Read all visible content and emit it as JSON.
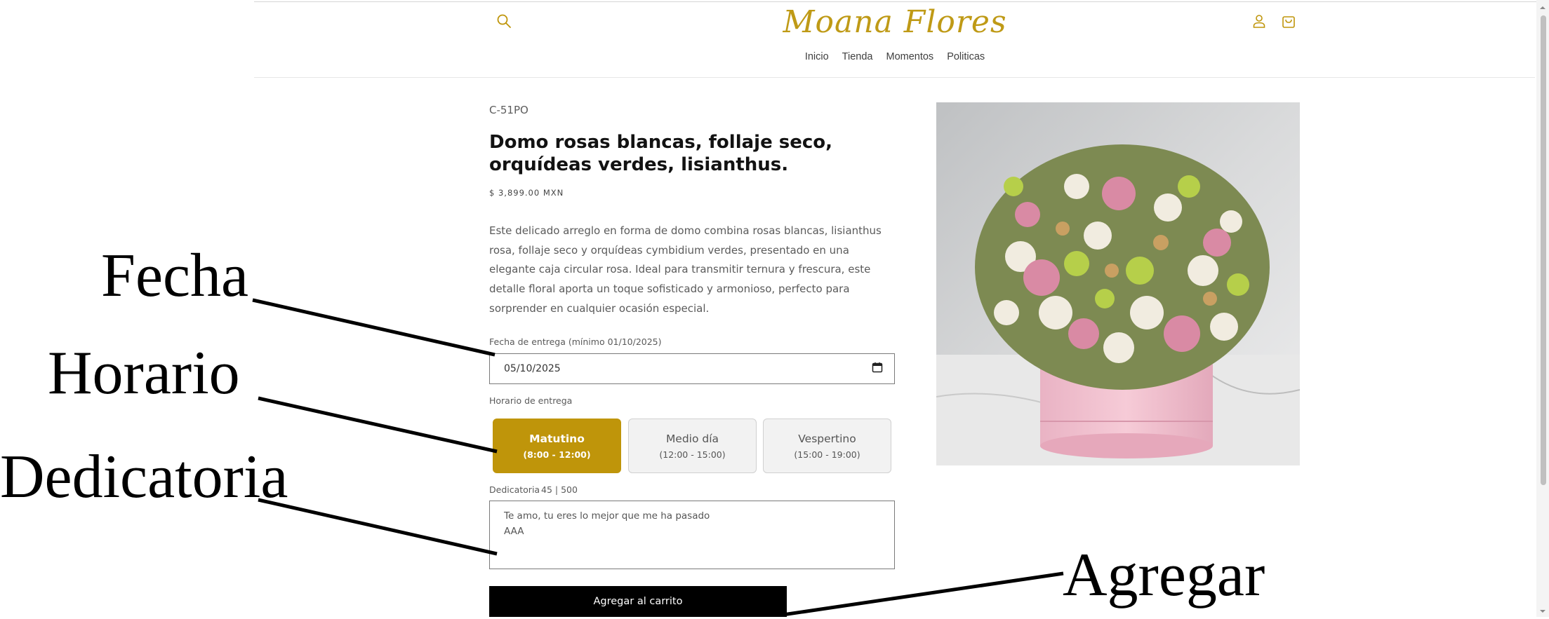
{
  "store": {
    "logo_text": "Moana Flores",
    "nav": [
      "Inicio",
      "Tienda",
      "Momentos",
      "Politicas"
    ],
    "icons": {
      "search": "search-icon",
      "account": "account-icon",
      "cart": "cart-icon"
    },
    "accent_color": "#bf950a"
  },
  "product": {
    "sku": "C-51PO",
    "title": "Domo rosas blancas, follaje seco, orquídeas verdes, lisianthus.",
    "price": "$ 3,899.00 MXN",
    "description": "Este delicado arreglo en forma de domo combina rosas blancas, lisianthus rosa, follaje seco y orquídeas cymbidium verdes, presentado en una elegante caja circular rosa. Ideal para transmitir ternura y frescura, este detalle floral aporta un toque sofisticado y armonioso, perfecto para sorprender en cualquier ocasión especial.",
    "image_alt": "Arreglo floral en caja rosa"
  },
  "form": {
    "date_label": "Fecha de entrega (mínimo 01/10/2025)",
    "date_value": "05/10/2025",
    "schedule_label": "Horario de entrega",
    "slots": [
      {
        "name": "Matutino",
        "time": "(8:00 - 12:00)",
        "selected": true
      },
      {
        "name": "Medio día",
        "time": "(12:00 - 15:00)",
        "selected": false
      },
      {
        "name": "Vespertino",
        "time": "(15:00 - 19:00)",
        "selected": false
      }
    ],
    "dedication_label": "Dedicatoria",
    "dedication_count": "45 | 500",
    "dedication_text": "Te amo, tu eres lo mejor que me ha pasado\nAAA",
    "add_to_cart": "Agregar al carrito"
  },
  "annotations": {
    "fecha": "Fecha",
    "horario": "Horario",
    "dedicatoria": "Dedicatoria",
    "agregar": "Agregar"
  }
}
